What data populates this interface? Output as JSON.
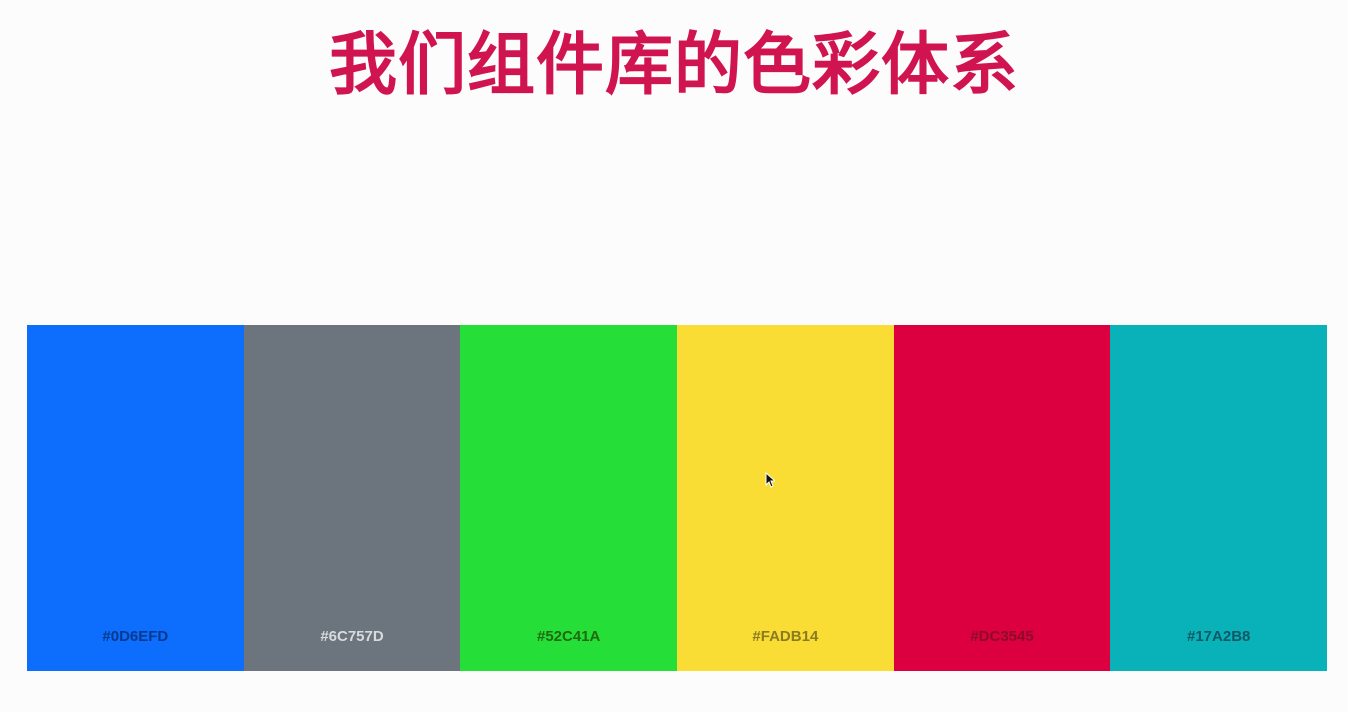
{
  "title": "我们组件库的色彩体系",
  "swatches": [
    {
      "hex": "#0D6EFD",
      "label": "#0D6EFD",
      "label_color": "#073a8f"
    },
    {
      "hex": "#6C757D",
      "label": "#6C757D",
      "label_color": "#d8dbde"
    },
    {
      "hex": "#52C41A",
      "label": "#52C41A",
      "label_color": "#1f6a10",
      "render_color": "#25de38"
    },
    {
      "hex": "#FADB14",
      "label": "#FADB14",
      "label_color": "#8a7a20",
      "render_color": "#f9dd35"
    },
    {
      "hex": "#DC3545",
      "label": "#DC3545",
      "label_color": "#8c0c28",
      "render_color": "#dc0041"
    },
    {
      "hex": "#17A2B8",
      "label": "#17A2B8",
      "label_color": "#0d5a66",
      "render_color": "#09b2b8"
    }
  ],
  "colors": {
    "title": "#d0144f",
    "background": "#fdfcfd"
  },
  "icons": {
    "cursor": "mouse-pointer-icon"
  }
}
